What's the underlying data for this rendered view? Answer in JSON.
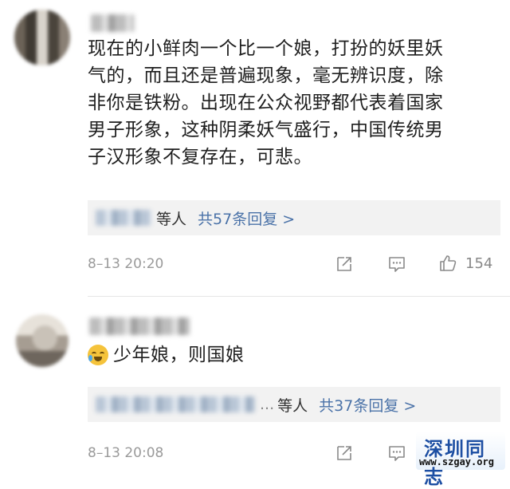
{
  "comments": [
    {
      "text_lines": [
        "现在的小鲜肉一个比一个娘，打扮的妖里妖",
        "气的，而且还是普遍现象，毫无辨识度，除",
        "非你是铁粉。出现在公众视野都代表着国家",
        "男子形象，这种阴柔妖气盛行，中国传统男",
        "子汉形象不复存在，可悲。"
      ],
      "reply_suffix": "等人",
      "reply_link": "共57条回复 >",
      "timestamp": "8–13 20:20",
      "like_count": "154"
    },
    {
      "emoji": "laugh-cry-emoji",
      "text": "少年娘，则国娘",
      "reply_ellipsis": "...",
      "reply_suffix": "等人",
      "reply_link": "共37条回复 >",
      "timestamp": "8–13 20:08"
    }
  ],
  "watermark": {
    "title": "深圳同志",
    "url": "www.szgay.org"
  },
  "colors": {
    "link": "#4a72a8",
    "meta": "#9a9a9a",
    "reply_bg": "#f2f2f2",
    "watermark": "#1d4fa3"
  }
}
